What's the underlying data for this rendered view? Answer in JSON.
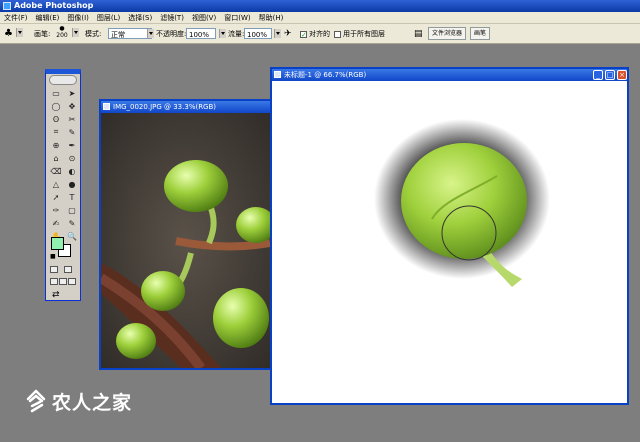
{
  "app": {
    "title": "Adobe Photoshop"
  },
  "menu": [
    "文件(F)",
    "编辑(E)",
    "图像(I)",
    "图层(L)",
    "选择(S)",
    "滤镜(T)",
    "视图(V)",
    "窗口(W)",
    "帮助(H)"
  ],
  "options": {
    "brush_label": "画笔:",
    "brush_size": "200",
    "mode_label": "模式:",
    "mode_value": "正常",
    "opacity_label": "不透明度:",
    "opacity_value": "100%",
    "flow_label": "流量:",
    "flow_value": "100%",
    "aligned_label": "对齐的",
    "aligned_checked": true,
    "all_layers_label": "用于所有图层",
    "all_layers_checked": false
  },
  "palette_tabs": [
    "文件浏览器",
    "画笔"
  ],
  "tools": [
    "▭",
    "➤",
    "◯",
    "✥",
    "ʘ",
    "✂",
    "⌗",
    "✎",
    "⊕",
    "✒",
    "⌂",
    "⊙",
    "⌫",
    "◐",
    "△",
    "●",
    "➚",
    "T",
    "✑",
    "▢",
    "✍",
    "✎",
    "✋",
    "🔍"
  ],
  "colors": {
    "foreground": "#8ff0b0",
    "background": "#ffffff",
    "title_bar": "#0b3aa6"
  },
  "docs": {
    "photo": {
      "title": "IMG_0020.JPG @ 33.3%(RGB)"
    },
    "canvas": {
      "title": "未标题-1 @ 66.7%(RGB)"
    }
  },
  "watermark": "农人之家"
}
